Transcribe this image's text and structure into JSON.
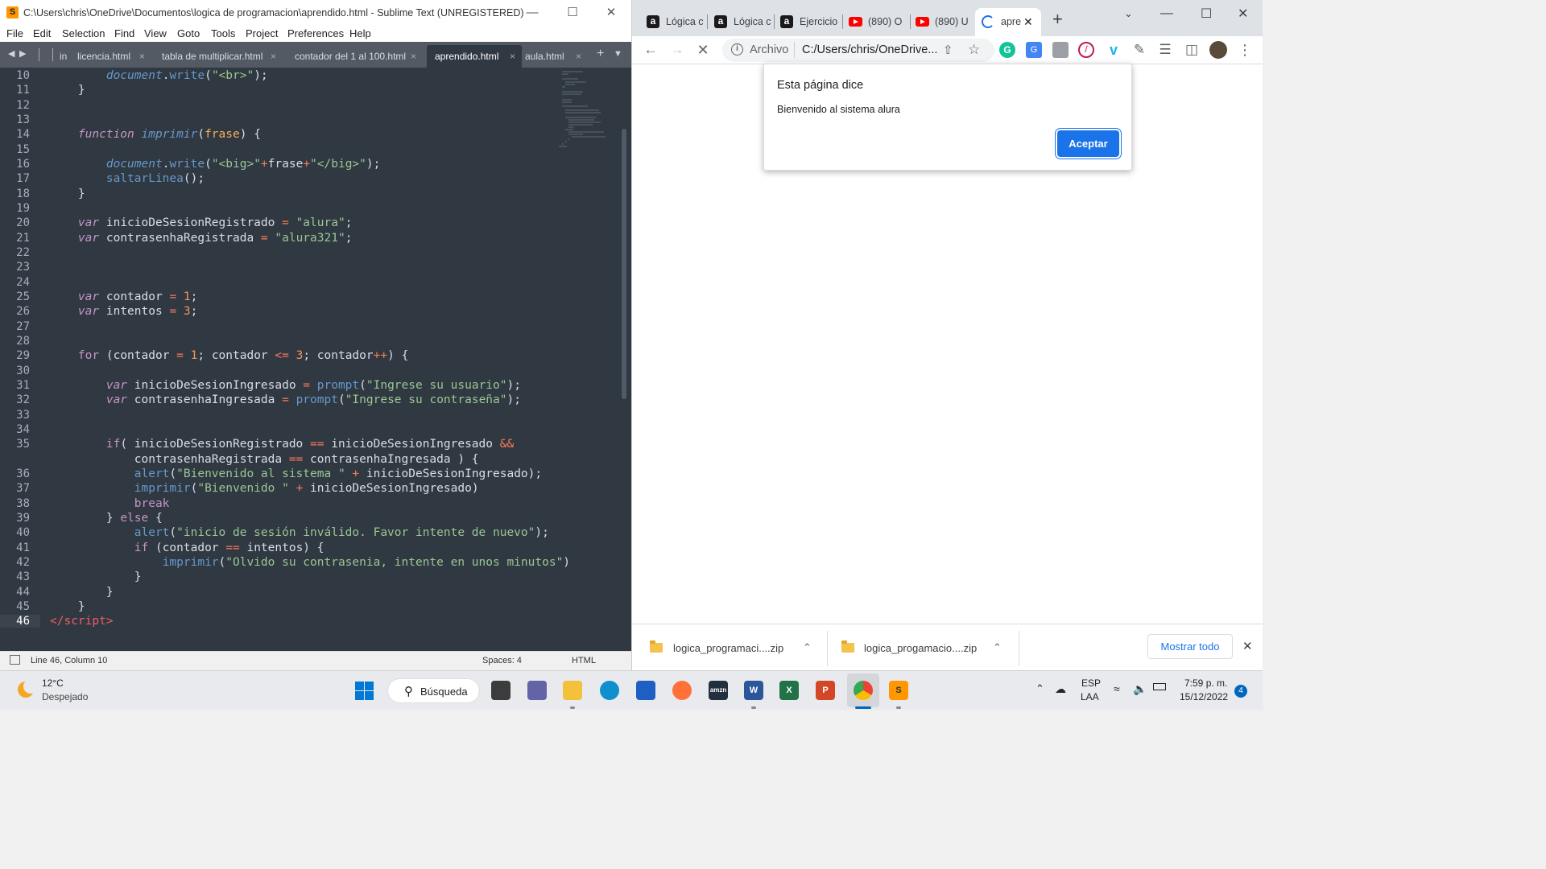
{
  "sublime": {
    "title": "C:\\Users\\chris\\OneDrive\\Documentos\\logica de programacion\\aprendido.html - Sublime Text (UNREGISTERED)",
    "menu": [
      "File",
      "Edit",
      "Selection",
      "Find",
      "View",
      "Goto",
      "Tools",
      "Project",
      "Preferences",
      "Help"
    ],
    "tabs": [
      {
        "label": "in"
      },
      {
        "label": "licencia.html"
      },
      {
        "label": "tabla de multiplicar.html"
      },
      {
        "label": "contador del 1 al 100.html"
      },
      {
        "label": "aprendido.html"
      },
      {
        "label": "aula.html"
      }
    ],
    "tab_close": "×",
    "line_numbers": [
      "10",
      "11",
      "12",
      "13",
      "14",
      "15",
      "16",
      "17",
      "18",
      "19",
      "20",
      "21",
      "22",
      "23",
      "24",
      "25",
      "26",
      "27",
      "28",
      "29",
      "30",
      "31",
      "32",
      "33",
      "34",
      "35",
      "",
      "36",
      "37",
      "38",
      "39",
      "40",
      "41",
      "42",
      "43",
      "44",
      "45",
      "46"
    ],
    "status": {
      "position": "Line 46, Column 10",
      "indent": "Spaces: 4",
      "syntax": "HTML"
    }
  },
  "chrome": {
    "tabs": [
      {
        "label": "Lógica c"
      },
      {
        "label": "Lógica c"
      },
      {
        "label": "Ejercicio"
      },
      {
        "label": "(890) O"
      },
      {
        "label": "(890) U"
      },
      {
        "label": "apre"
      }
    ],
    "omnibox": {
      "scheme_label": "Archivo",
      "url": "C:/Users/chris/OneDrive..."
    },
    "dialog": {
      "title": "Esta página dice",
      "message": "Bienvenido al sistema alura",
      "ok_label": "Aceptar"
    },
    "downloads": {
      "items": [
        {
          "name": "logica_programaci....zip"
        },
        {
          "name": "logica_progamacio....zip"
        }
      ],
      "show_all_label": "Mostrar todo"
    }
  },
  "taskbar": {
    "weather_temp": "12°C",
    "weather_desc": "Despejado",
    "search_label": "Búsqueda",
    "language": "ESP",
    "layout": "LAA",
    "time": "7:59 p. m.",
    "date": "15/12/2022",
    "notification_count": "4"
  },
  "colors": {
    "editor_bg": "#303841",
    "accent_blue": "#1a73e8"
  }
}
